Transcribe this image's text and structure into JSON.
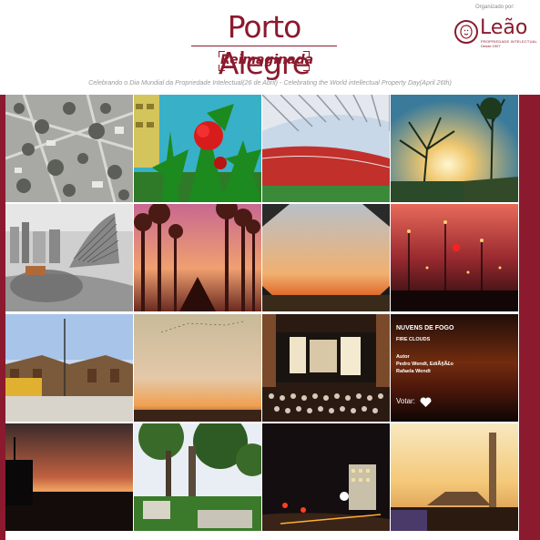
{
  "header": {
    "title": "Porto Alegre",
    "subtitle_word": "Reimaginada",
    "tagline": "Celebrando o Dia Mundial da Propriedade Intelectual(26 de Abril) - Celebrating the World intellectual Property Day(April 26th)"
  },
  "organizer": {
    "label": "Organizado por:",
    "name": "Leão",
    "tag": "PROPRIEDADE INTELECTUAL",
    "since": "Desde 1907"
  },
  "colors": {
    "brand": "#8b1a2e",
    "subtitle_text": "#999999"
  },
  "photos": [
    "aerial-city-bw",
    "red-flower-palms",
    "stadium-interior",
    "tree-sunset",
    "city-aerial-bw",
    "palm-avenue-sunset",
    "sunset-horizon",
    "street-night-lights",
    "harbor-warehouses",
    "sky-birds",
    "theater-audience",
    "fire-clouds-sunset",
    "harbor-ship-dusk",
    "park-trees",
    "city-night-traffic",
    "chimney-sunset"
  ],
  "hover_card": {
    "title": "NUVENS DE FOGO",
    "subtitle": "FIRE CLOUDS",
    "autor_label": "Autor",
    "author_line1": "Pedro Wendt, EdiÃ§Ã£o",
    "author_line2": "Rafaela Wendt",
    "vote_label": "Votar:",
    "vote_icon": "heart-icon"
  }
}
